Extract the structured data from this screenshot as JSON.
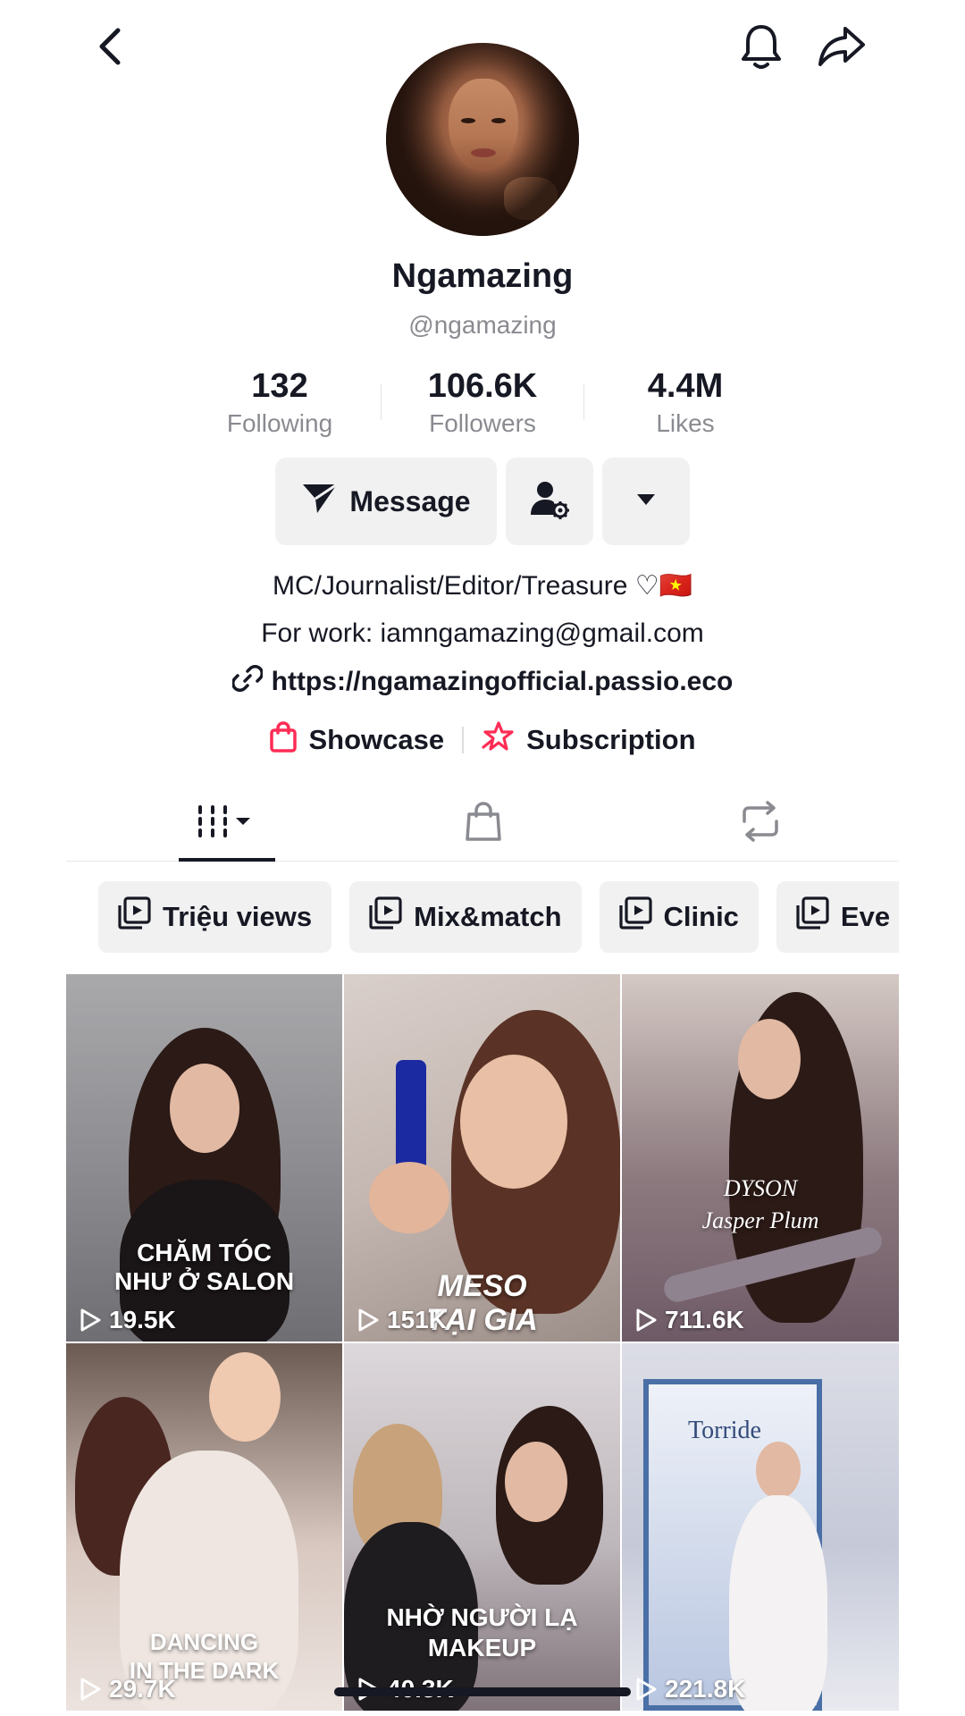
{
  "header": {
    "back_icon": "chevron-left-icon",
    "notification_icon": "bell-icon",
    "share_icon": "share-arrow-icon"
  },
  "profile": {
    "display_name": "Ngamazing",
    "username": "@ngamazing",
    "stats": [
      {
        "value": "132",
        "label": "Following"
      },
      {
        "value": "106.6K",
        "label": "Followers"
      },
      {
        "value": "4.4M",
        "label": "Likes"
      }
    ],
    "buttons": {
      "message_label": "Message"
    },
    "bio_line1": "MC/Journalist/Editor/Treasure ♡🇻🇳",
    "bio_line2": "For work: iamngamazing@gmail.com",
    "link": "https://ngamazingofficial.passio.eco",
    "showcase_label": "Showcase",
    "subscription_label": "Subscription"
  },
  "tabs": [
    {
      "icon": "grid-videos-icon",
      "active": true
    },
    {
      "icon": "shopping-bag-icon",
      "active": false
    },
    {
      "icon": "repost-icon",
      "active": false
    }
  ],
  "playlists": [
    "Triệu views",
    "Mix&match",
    "Clinic",
    "Eve"
  ],
  "videos": [
    {
      "caption": "CHĂM TÓC\nNHƯ Ở SALON",
      "views": "19.5K"
    },
    {
      "caption": "MESO\nTẠI GIA",
      "views": "151K"
    },
    {
      "caption": "DYSON\nJasper Plum",
      "views": "711.6K"
    },
    {
      "caption": "DANCING\nIN THE DARK",
      "views": "29.7K"
    },
    {
      "caption": "NHỜ NGƯỜI LẠ\nMAKEUP",
      "views": "40.3K"
    },
    {
      "caption": "Torride",
      "views": "221.8K"
    }
  ],
  "colors": {
    "accent_red": "#fe2c55",
    "text_primary": "#161823",
    "text_secondary": "#8a8b91",
    "button_bg": "#f1f1f2"
  }
}
